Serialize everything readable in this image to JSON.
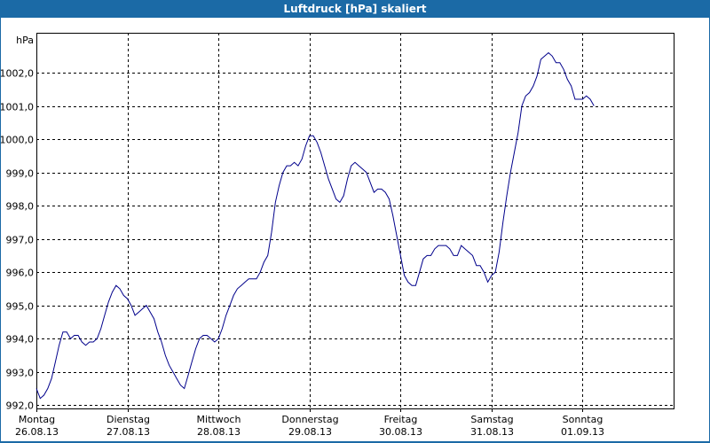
{
  "window": {
    "title": "Luftdruck [hPa] skaliert"
  },
  "colors": {
    "titlebar": "#1b6aa6",
    "series": "#00008b"
  },
  "chart_data": {
    "type": "line",
    "title": "Luftdruck [hPa] skaliert",
    "ylabel": "hPa",
    "ylim": [
      991.9,
      1003.2
    ],
    "yticks": [
      992.0,
      993.0,
      994.0,
      995.0,
      996.0,
      997.0,
      998.0,
      999.0,
      1000.0,
      1001.0,
      1002.0
    ],
    "ytick_labels": [
      "992,0",
      "993,0",
      "994,0",
      "995,0",
      "996,0",
      "997,0",
      "998,0",
      "999,0",
      "1000,0",
      "1001,0",
      "1002,0"
    ],
    "xlim": [
      "26.08.13 00:00",
      "01.09.13 24:00"
    ],
    "x_categories": [
      {
        "day": "Montag",
        "date": "26.08.13"
      },
      {
        "day": "Dienstag",
        "date": "27.08.13"
      },
      {
        "day": "Mittwoch",
        "date": "28.08.13"
      },
      {
        "day": "Donnerstag",
        "date": "29.08.13"
      },
      {
        "day": "Freitag",
        "date": "30.08.13"
      },
      {
        "day": "Samstag",
        "date": "31.08.13"
      },
      {
        "day": "Sonntag",
        "date": "01.09.13"
      }
    ],
    "grid": true,
    "series": [
      {
        "color": "#00008b",
        "x_unit": "hours since 26.08.13 00:00",
        "points": [
          [
            0,
            992.5
          ],
          [
            1,
            992.2
          ],
          [
            2,
            992.3
          ],
          [
            3,
            992.5
          ],
          [
            4,
            992.8
          ],
          [
            5,
            993.3
          ],
          [
            6,
            993.8
          ],
          [
            7,
            994.2
          ],
          [
            8,
            994.2
          ],
          [
            9,
            994.0
          ],
          [
            10,
            994.1
          ],
          [
            11,
            994.1
          ],
          [
            12,
            993.9
          ],
          [
            13,
            993.8
          ],
          [
            14,
            993.9
          ],
          [
            15,
            993.9
          ],
          [
            16,
            994.0
          ],
          [
            17,
            994.3
          ],
          [
            18,
            994.7
          ],
          [
            19,
            995.1
          ],
          [
            20,
            995.4
          ],
          [
            21,
            995.6
          ],
          [
            22,
            995.5
          ],
          [
            23,
            995.3
          ],
          [
            24,
            995.2
          ],
          [
            25,
            995.0
          ],
          [
            26,
            994.7
          ],
          [
            27,
            994.8
          ],
          [
            28,
            994.9
          ],
          [
            29,
            995.0
          ],
          [
            30,
            994.8
          ],
          [
            31,
            994.6
          ],
          [
            32,
            994.2
          ],
          [
            33,
            993.9
          ],
          [
            34,
            993.5
          ],
          [
            35,
            993.2
          ],
          [
            36,
            993.0
          ],
          [
            37,
            992.8
          ],
          [
            38,
            992.6
          ],
          [
            39,
            992.5
          ],
          [
            40,
            992.9
          ],
          [
            41,
            993.3
          ],
          [
            42,
            993.7
          ],
          [
            43,
            994.0
          ],
          [
            44,
            994.1
          ],
          [
            45,
            994.1
          ],
          [
            46,
            994.0
          ],
          [
            47,
            993.9
          ],
          [
            48,
            994.0
          ],
          [
            49,
            994.3
          ],
          [
            50,
            994.7
          ],
          [
            51,
            995.0
          ],
          [
            52,
            995.3
          ],
          [
            53,
            995.5
          ],
          [
            54,
            995.6
          ],
          [
            55,
            995.7
          ],
          [
            56,
            995.8
          ],
          [
            57,
            995.8
          ],
          [
            58,
            995.8
          ],
          [
            59,
            996.0
          ],
          [
            60,
            996.3
          ],
          [
            61,
            996.5
          ],
          [
            62,
            997.2
          ],
          [
            63,
            998.1
          ],
          [
            64,
            998.6
          ],
          [
            65,
            999.0
          ],
          [
            66,
            999.2
          ],
          [
            67,
            999.2
          ],
          [
            68,
            999.3
          ],
          [
            69,
            999.2
          ],
          [
            70,
            999.4
          ],
          [
            71,
            999.8
          ],
          [
            72,
            1000.1
          ],
          [
            73,
            1000.1
          ],
          [
            74,
            999.9
          ],
          [
            75,
            999.6
          ],
          [
            76,
            999.2
          ],
          [
            77,
            998.8
          ],
          [
            78,
            998.5
          ],
          [
            79,
            998.2
          ],
          [
            80,
            998.1
          ],
          [
            81,
            998.3
          ],
          [
            82,
            998.8
          ],
          [
            83,
            999.2
          ],
          [
            84,
            999.3
          ],
          [
            85,
            999.2
          ],
          [
            86,
            999.1
          ],
          [
            87,
            999.0
          ],
          [
            88,
            998.7
          ],
          [
            89,
            998.4
          ],
          [
            90,
            998.5
          ],
          [
            91,
            998.5
          ],
          [
            92,
            998.4
          ],
          [
            93,
            998.2
          ],
          [
            94,
            997.7
          ],
          [
            95,
            997.1
          ],
          [
            96,
            996.5
          ],
          [
            97,
            995.9
          ],
          [
            98,
            995.7
          ],
          [
            99,
            995.6
          ],
          [
            100,
            995.6
          ],
          [
            101,
            996.0
          ],
          [
            102,
            996.4
          ],
          [
            103,
            996.5
          ],
          [
            104,
            996.5
          ],
          [
            105,
            996.7
          ],
          [
            106,
            996.8
          ],
          [
            107,
            996.8
          ],
          [
            108,
            996.8
          ],
          [
            109,
            996.7
          ],
          [
            110,
            996.5
          ],
          [
            111,
            996.5
          ],
          [
            112,
            996.8
          ],
          [
            113,
            996.7
          ],
          [
            114,
            996.6
          ],
          [
            115,
            996.5
          ],
          [
            116,
            996.2
          ],
          [
            117,
            996.2
          ],
          [
            118,
            996.0
          ],
          [
            119,
            995.7
          ],
          [
            120,
            995.9
          ],
          [
            121,
            996.0
          ],
          [
            122,
            996.6
          ],
          [
            123,
            997.5
          ],
          [
            124,
            998.3
          ],
          [
            125,
            999.0
          ],
          [
            126,
            999.6
          ],
          [
            127,
            1000.2
          ],
          [
            128,
            1001.0
          ],
          [
            129,
            1001.3
          ],
          [
            130,
            1001.4
          ],
          [
            131,
            1001.6
          ],
          [
            132,
            1001.9
          ],
          [
            133,
            1002.4
          ],
          [
            134,
            1002.5
          ],
          [
            135,
            1002.6
          ],
          [
            136,
            1002.5
          ],
          [
            137,
            1002.3
          ],
          [
            138,
            1002.3
          ],
          [
            139,
            1002.1
          ],
          [
            140,
            1001.8
          ],
          [
            141,
            1001.6
          ],
          [
            142,
            1001.2
          ],
          [
            143,
            1001.2
          ],
          [
            144,
            1001.2
          ],
          [
            145,
            1001.3
          ],
          [
            146,
            1001.2
          ],
          [
            147,
            1001.0
          ]
        ]
      }
    ]
  }
}
